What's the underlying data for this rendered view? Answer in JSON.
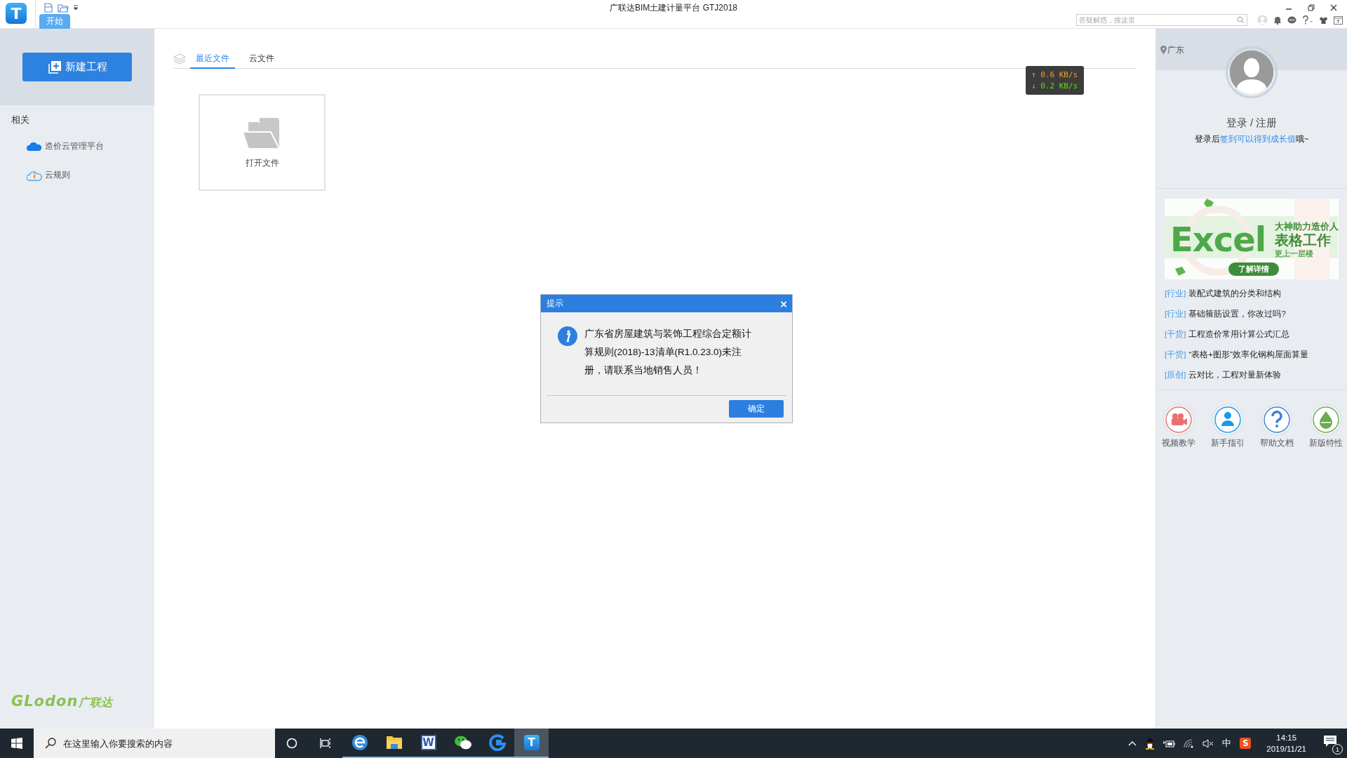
{
  "title_bar": {
    "app_icon": "T",
    "title": "广联达BIM土建计量平台 GTJ2018",
    "tabs": [
      {
        "label": "开始",
        "selected": true
      }
    ],
    "search": {
      "placeholder": "答疑解惑，搜这里"
    }
  },
  "sidebar": {
    "new_project": "新建工程",
    "section_title": "相关",
    "items": [
      {
        "label": "造价云管理平台",
        "kind": "cloud"
      },
      {
        "label": "云规则",
        "kind": "cloud-info"
      }
    ],
    "logo": {
      "latin": "GLodon",
      "chinese": "广联达"
    }
  },
  "main": {
    "tabs": [
      {
        "label": "最近文件",
        "selected": true
      },
      {
        "label": "云文件",
        "selected": false
      }
    ],
    "open_file": "打开文件",
    "net_speed": {
      "up": "↑ 0.6 KB/s",
      "down": "↓ 0.2 KB/s"
    }
  },
  "right_panel": {
    "location": "广东",
    "login": "登录 / 注册",
    "login_hint": {
      "before": "登录后",
      "link": "签到可以得到成长值",
      "after": "哦~"
    },
    "banner": {
      "title": "Excel",
      "line1": "大神助力造价人",
      "line2": "表格工作",
      "line3": "更上一层楼",
      "button": "了解详情"
    },
    "news": [
      {
        "tag": "[行业]",
        "title": "装配式建筑的分类和结构"
      },
      {
        "tag": "[行业]",
        "title": "基础箍筋设置，你改过吗?"
      },
      {
        "tag": "[干货]",
        "title": "工程造价常用计算公式汇总"
      },
      {
        "tag": "[干货]",
        "title": "“表格+图形”效率化钢构屋面算量"
      },
      {
        "tag": "[原创]",
        "title": "云对比，工程对量新体验"
      }
    ],
    "shortcuts": [
      {
        "label": "视频教学",
        "kind": "video"
      },
      {
        "label": "新手指引",
        "kind": "guide"
      },
      {
        "label": "帮助文档",
        "kind": "help"
      },
      {
        "label": "新版特性",
        "kind": "new"
      }
    ]
  },
  "dialog": {
    "title": "提示",
    "close": "×",
    "message": "广东省房屋建筑与装饰工程综合定额计算规则(2018)-13清单(R1.0.23.0)未注册，请联系当地销售人员！",
    "ok": "确定"
  },
  "taskbar": {
    "search": {
      "placeholder": "在这里输入你要搜索的内容"
    },
    "apps": [
      {
        "kind": "edge",
        "selected": false
      },
      {
        "kind": "explorer",
        "selected": false
      },
      {
        "kind": "word",
        "glyph": "W",
        "selected": false
      },
      {
        "kind": "wechat",
        "selected": false
      },
      {
        "kind": "g-app",
        "selected": false
      },
      {
        "kind": "t-app",
        "glyph": "T",
        "selected": true
      }
    ],
    "ime": "中",
    "sogou": "S",
    "time": "14:15",
    "date": "2019/11/21",
    "notifications": "1"
  }
}
